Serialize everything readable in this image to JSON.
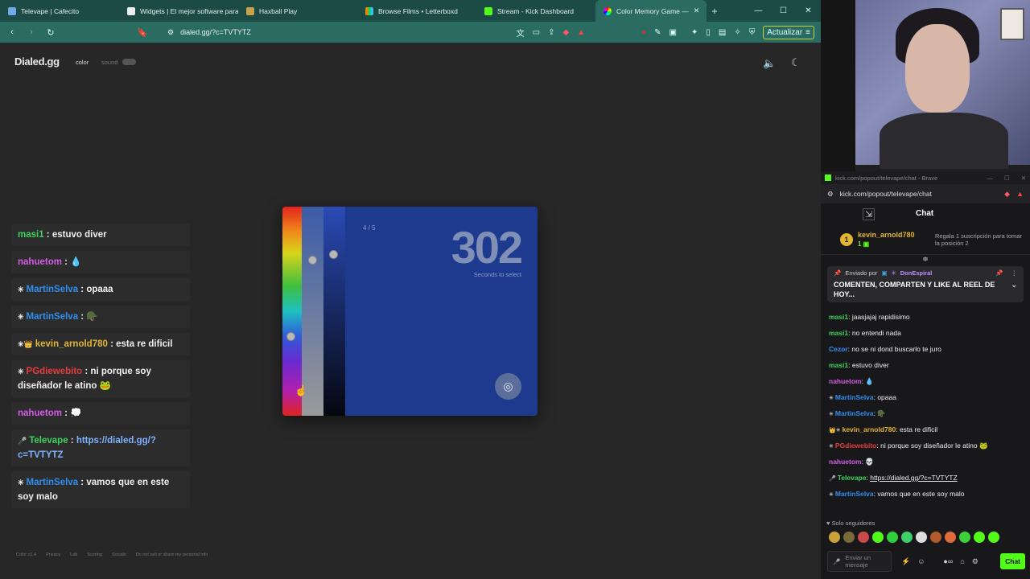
{
  "browser": {
    "tabs": [
      {
        "label": "Televape | Cafecito",
        "color": "#6fa9e8"
      },
      {
        "label": "Widgets | El mejor software para",
        "color": "#eeeeee"
      },
      {
        "label": "Haxball Play",
        "color": "#c9a24a"
      },
      {
        "label": "Browse Films • Letterboxd",
        "color": "#ff8000"
      },
      {
        "label": "Stream - Kick Dashboard",
        "color": "#53fc18"
      },
      {
        "label": "Color Memory Game —",
        "color": "#e04fd0"
      }
    ],
    "url": "dialed.gg/?c=TVTYTZ",
    "update_label": "Actualizar"
  },
  "page": {
    "logo": "Dialed.gg",
    "mode_color": "color",
    "mode_sound": "sound",
    "footer": [
      "Color v1.4",
      "Privacy",
      "Lab",
      "Scoring",
      "Socials",
      "Do not sell or share my personal info"
    ]
  },
  "game": {
    "round": "4 / 5",
    "timer": "302",
    "timer_label": "Seconds to select",
    "card_color": "#1e3a8f"
  },
  "overlay_chat": [
    {
      "user": "masi1",
      "user_color": "#3ed35e",
      "text": "estuvo diver",
      "badge": ""
    },
    {
      "user": "nahuetom",
      "user_color": "#d45ce8",
      "text": "💧",
      "badge": ""
    },
    {
      "user": "MartinSelva",
      "user_color": "#2f8ff2",
      "text": "opaaa",
      "badge": "✳"
    },
    {
      "user": "MartinSelva",
      "user_color": "#2f8ff2",
      "text": "🪖",
      "badge": "✳"
    },
    {
      "user": "kevin_arnold780",
      "user_color": "#e3b533",
      "text": "esta re dificil",
      "badge": "✳👑"
    },
    {
      "user": "PGdiewebito",
      "user_color": "#e83a3a",
      "text": "ni porque soy diseñador le atino 🐸",
      "badge": "✳"
    },
    {
      "user": "nahuetom",
      "user_color": "#d45ce8",
      "text": "💭",
      "badge": ""
    },
    {
      "user": "Televape",
      "user_color": "#3ed35e",
      "text": "https://dialed.gg/?c=TVTYTZ",
      "badge": "🎤"
    },
    {
      "user": "MartinSelva",
      "user_color": "#2f8ff2",
      "text": "vamos que en este soy malo",
      "badge": "✳"
    }
  ],
  "popout": {
    "title": "kick.com/popout/televape/chat - Brave",
    "url": "kick.com/popout/televape/chat",
    "chat_title": "Chat",
    "sub_user": "kevin_arnold780",
    "sub_level": "1",
    "gift_text": "Regala 1 suscripción para tomar la posición 2",
    "pinned_by_label": "Enviado por",
    "pinned_by": "DonEspiral",
    "pinned_text": "COMENTEN, COMPARTEN Y LIKE AL REEL DE HOY...",
    "messages": [
      {
        "user": "masi1",
        "color": "#3ed35e",
        "text": "jaasjajaj rapidisimo",
        "badge": ""
      },
      {
        "user": "masi1",
        "color": "#3ed35e",
        "text": "no entendi nada",
        "badge": ""
      },
      {
        "user": "Cezor",
        "color": "#2f8ff2",
        "text": "no se ni dond buscarlo te juro",
        "badge": ""
      },
      {
        "user": "masi1",
        "color": "#3ed35e",
        "text": "estuvo diver",
        "badge": ""
      },
      {
        "user": "nahuetom",
        "color": "#d45ce8",
        "text": "💧",
        "badge": ""
      },
      {
        "user": "MartinSelva",
        "color": "#2f8ff2",
        "text": "opaaa",
        "badge": "✳"
      },
      {
        "user": "MartinSelva",
        "color": "#2f8ff2",
        "text": "🪖",
        "badge": "✳"
      },
      {
        "user": "kevin_arnold780",
        "color": "#e3b533",
        "text": "esta re dificil",
        "badge": "👑✳"
      },
      {
        "user": "PGdiewebito",
        "color": "#e83a3a",
        "text": "ni porque soy diseñador le atino 🐸",
        "badge": "✳"
      },
      {
        "user": "nahuetom",
        "color": "#d45ce8",
        "text": "💀",
        "badge": ""
      },
      {
        "user": "Televape",
        "color": "#3ed35e",
        "text": "https://dialed.gg/?c=TVTYTZ",
        "badge": "🎤"
      },
      {
        "user": "MartinSelva",
        "color": "#2f8ff2",
        "text": "vamos que en este soy malo",
        "badge": "✳"
      }
    ],
    "followers_only": "Solo seguidores",
    "input_placeholder": "Enviar un mensaje",
    "chat_button": "Chat"
  }
}
